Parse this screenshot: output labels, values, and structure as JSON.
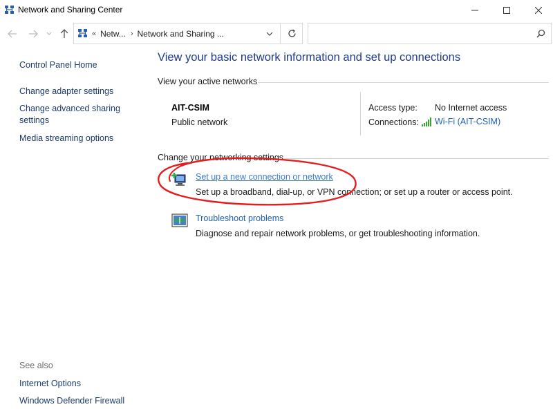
{
  "window": {
    "title": "Network and Sharing Center",
    "controls": [
      "minimize-icon",
      "maximize-icon",
      "close-icon"
    ]
  },
  "navigation": {
    "back_icon": "arrow-left-icon",
    "forward_icon": "arrow-right-icon",
    "recent_icon": "chevron-down-icon",
    "up_icon": "arrow-up-icon"
  },
  "address": {
    "overflow": "«",
    "segments": [
      "Netw...",
      "Network and Sharing ..."
    ],
    "separator": "›",
    "refresh_icon": "refresh-icon"
  },
  "search": {
    "placeholder": "",
    "icon": "search-icon"
  },
  "sidebar": {
    "home": "Control Panel Home",
    "links": [
      "Change adapter settings",
      "Change advanced sharing",
      "settings",
      "Media streaming options"
    ],
    "see_also_label": "See also",
    "see_also": [
      "Internet Options",
      "Windows Defender Firewall"
    ]
  },
  "main": {
    "title": "View your basic network information and set up connections",
    "active_networks_header": "View your active networks",
    "network": {
      "name": "AIT-CSIM",
      "category": "Public network",
      "access_type_label": "Access type:",
      "access_type_value": "No Internet access",
      "connections_label": "Connections:",
      "connection_value": "Wi-Fi (AIT-CSIM)"
    },
    "change_settings_header": "Change your networking settings",
    "tasks": [
      {
        "icon": "new-connection-icon",
        "link": "Set up a new connection or network",
        "description": "Set up a broadband, dial-up, or VPN connection; or set up a router or access point."
      },
      {
        "icon": "troubleshoot-icon",
        "link": "Troubleshoot problems",
        "description": "Diagnose and repair network problems, or get troubleshooting information."
      }
    ]
  },
  "colors": {
    "link": "#1f5fb5",
    "title": "#1e3a8a",
    "annotation": "#e41e1e",
    "wifi": "#3aa335"
  }
}
